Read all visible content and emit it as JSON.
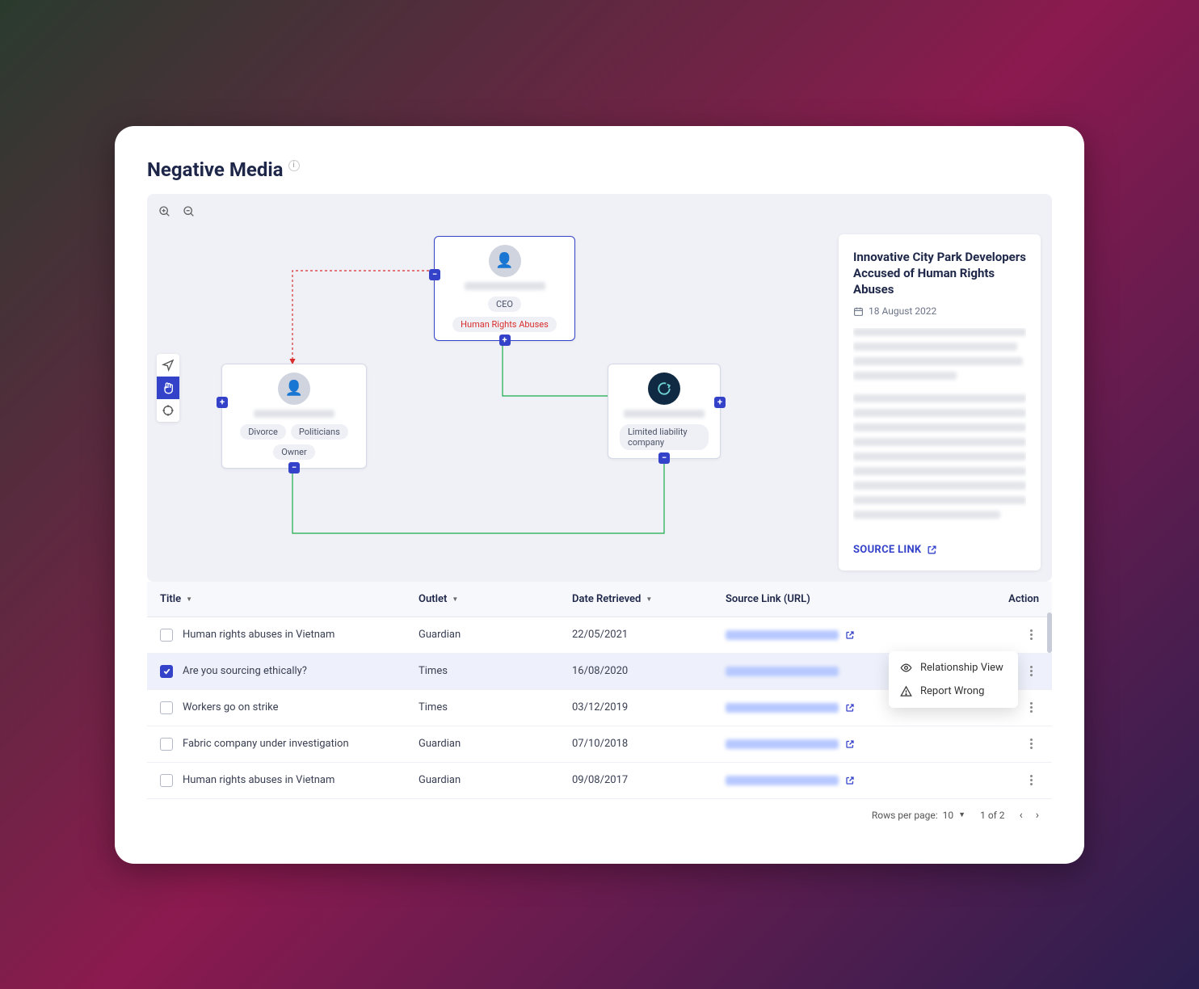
{
  "page": {
    "title": "Negative Media"
  },
  "graph": {
    "nodes": {
      "top": {
        "tags": [
          "CEO",
          "Human Rights Abuses"
        ],
        "tag_danger_index": 1
      },
      "left": {
        "tags": [
          "Divorce",
          "Politicians",
          "Owner"
        ]
      },
      "right": {
        "tags": [
          "Limited liability company"
        ]
      }
    }
  },
  "article": {
    "title": "Innovative City Park Developers Accused of Human Rights Abuses",
    "date": "18 August 2022",
    "source_link_label": "SOURCE LINK"
  },
  "table": {
    "columns": {
      "title": "Title",
      "outlet": "Outlet",
      "date": "Date Retrieved",
      "source": "Source Link (URL)",
      "action": "Action"
    },
    "rows": [
      {
        "checked": false,
        "title": "Human rights abuses in Vietnam",
        "outlet": "Guardian",
        "date": "22/05/2021"
      },
      {
        "checked": true,
        "title": "Are you sourcing ethically?",
        "outlet": "Times",
        "date": "16/08/2020"
      },
      {
        "checked": false,
        "title": "Workers go on strike",
        "outlet": "Times",
        "date": "03/12/2019"
      },
      {
        "checked": false,
        "title": "Fabric company under investigation",
        "outlet": "Guardian",
        "date": "07/10/2018"
      },
      {
        "checked": false,
        "title": "Human rights abuses in Vietnam",
        "outlet": "Guardian",
        "date": "09/08/2017"
      }
    ],
    "context_menu": {
      "relationship_view": "Relationship View",
      "report_wrong": "Report Wrong"
    },
    "pagination": {
      "rows_label": "Rows per page:",
      "rows_value": "10",
      "page_status": "1 of 2"
    }
  }
}
